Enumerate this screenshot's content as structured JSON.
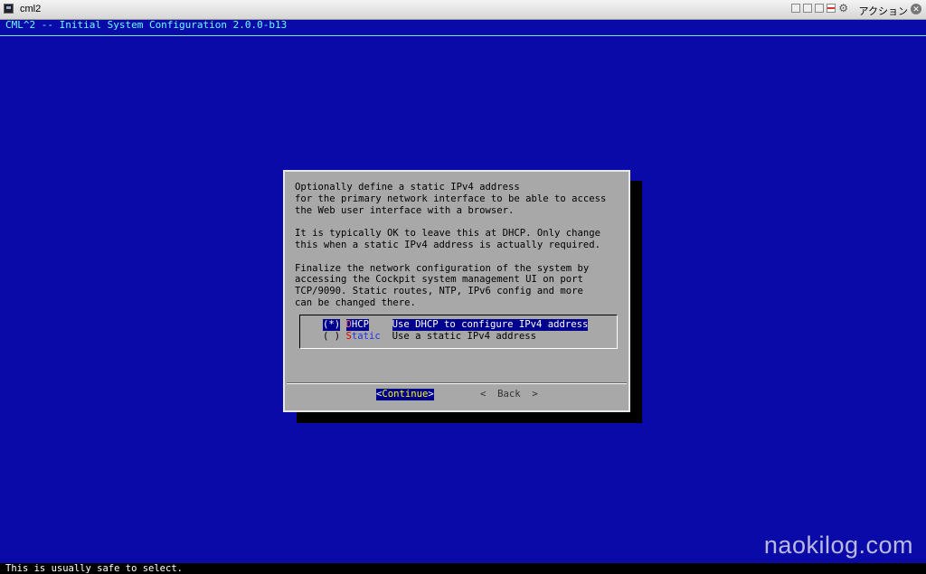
{
  "window": {
    "title": "cml2",
    "action_label": "アクション"
  },
  "console": {
    "header": "CML^2 -- Initial System Configuration 2.0.0-b13",
    "status": "This is usually safe to select."
  },
  "dialog": {
    "text": "Optionally define a static IPv4 address\nfor the primary network interface to be able to access\nthe Web user interface with a browser.\n\nIt is typically OK to leave this at DHCP. Only change\nthis when a static IPv4 address is actually required.\n\nFinalize the network configuration of the system by\naccessing the Cockpit system management UI on port\nTCP/9090. Static routes, NTP, IPv6 config and more\ncan be changed there.",
    "options": [
      {
        "marker": "(*)",
        "tag_first": "D",
        "tag_rest": "HCP",
        "desc": "Use DHCP to configure IPv4 address"
      },
      {
        "marker": "( )",
        "tag_first": "S",
        "tag_rest": "tatic",
        "desc": "Use a static IPv4 address"
      }
    ],
    "continue_label": "Continue",
    "back_label": "Back"
  },
  "watermark": "naokilog.com",
  "colors": {
    "background": "#0a0aa8",
    "dialog": "#a8a8a8",
    "selection": "#00008f",
    "header_text": "#66ffff"
  }
}
